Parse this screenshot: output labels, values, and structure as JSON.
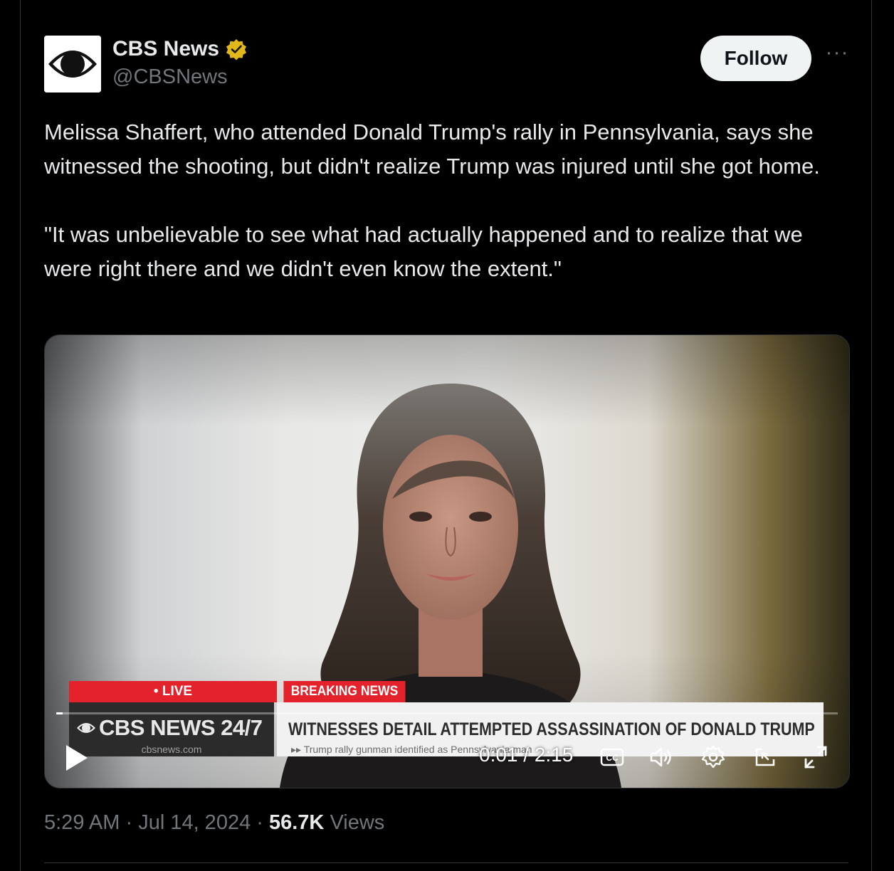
{
  "author": {
    "name": "CBS News",
    "handle": "@CBSNews",
    "verified_badge_color": "#e2b719"
  },
  "actions": {
    "follow_label": "Follow",
    "more_label": "···"
  },
  "tweet": {
    "paragraphs": [
      "Melissa Shaffert, who attended Donald Trump's rally in Pennsylvania, says she witnessed the shooting, but didn't realize Trump was injured until she got home.",
      "\"It was unbelievable to see what had actually happened and to realize that we were right there and we didn't even know the extent.\""
    ]
  },
  "video": {
    "live_label": "• LIVE",
    "breaking_label": "BREAKING NEWS",
    "brand": "CBS NEWS 24/7",
    "brand_site": "cbsnews.com",
    "headline": "WITNESSES DETAIL ATTEMPTED ASSASSINATION OF DONALD TRUMP",
    "ticker_sub": "▸▸ Trump rally gunman identified as Pennsylvania man",
    "current_time": "0:01",
    "duration": "2:15",
    "time_display": "0:01 / 2:15",
    "progress_fraction": 0.008,
    "colors": {
      "breaking_red": "#e3222b"
    }
  },
  "meta": {
    "time": "5:29 AM",
    "date": "Jul 14, 2024",
    "views_count": "56.7K",
    "views_label": "Views"
  }
}
